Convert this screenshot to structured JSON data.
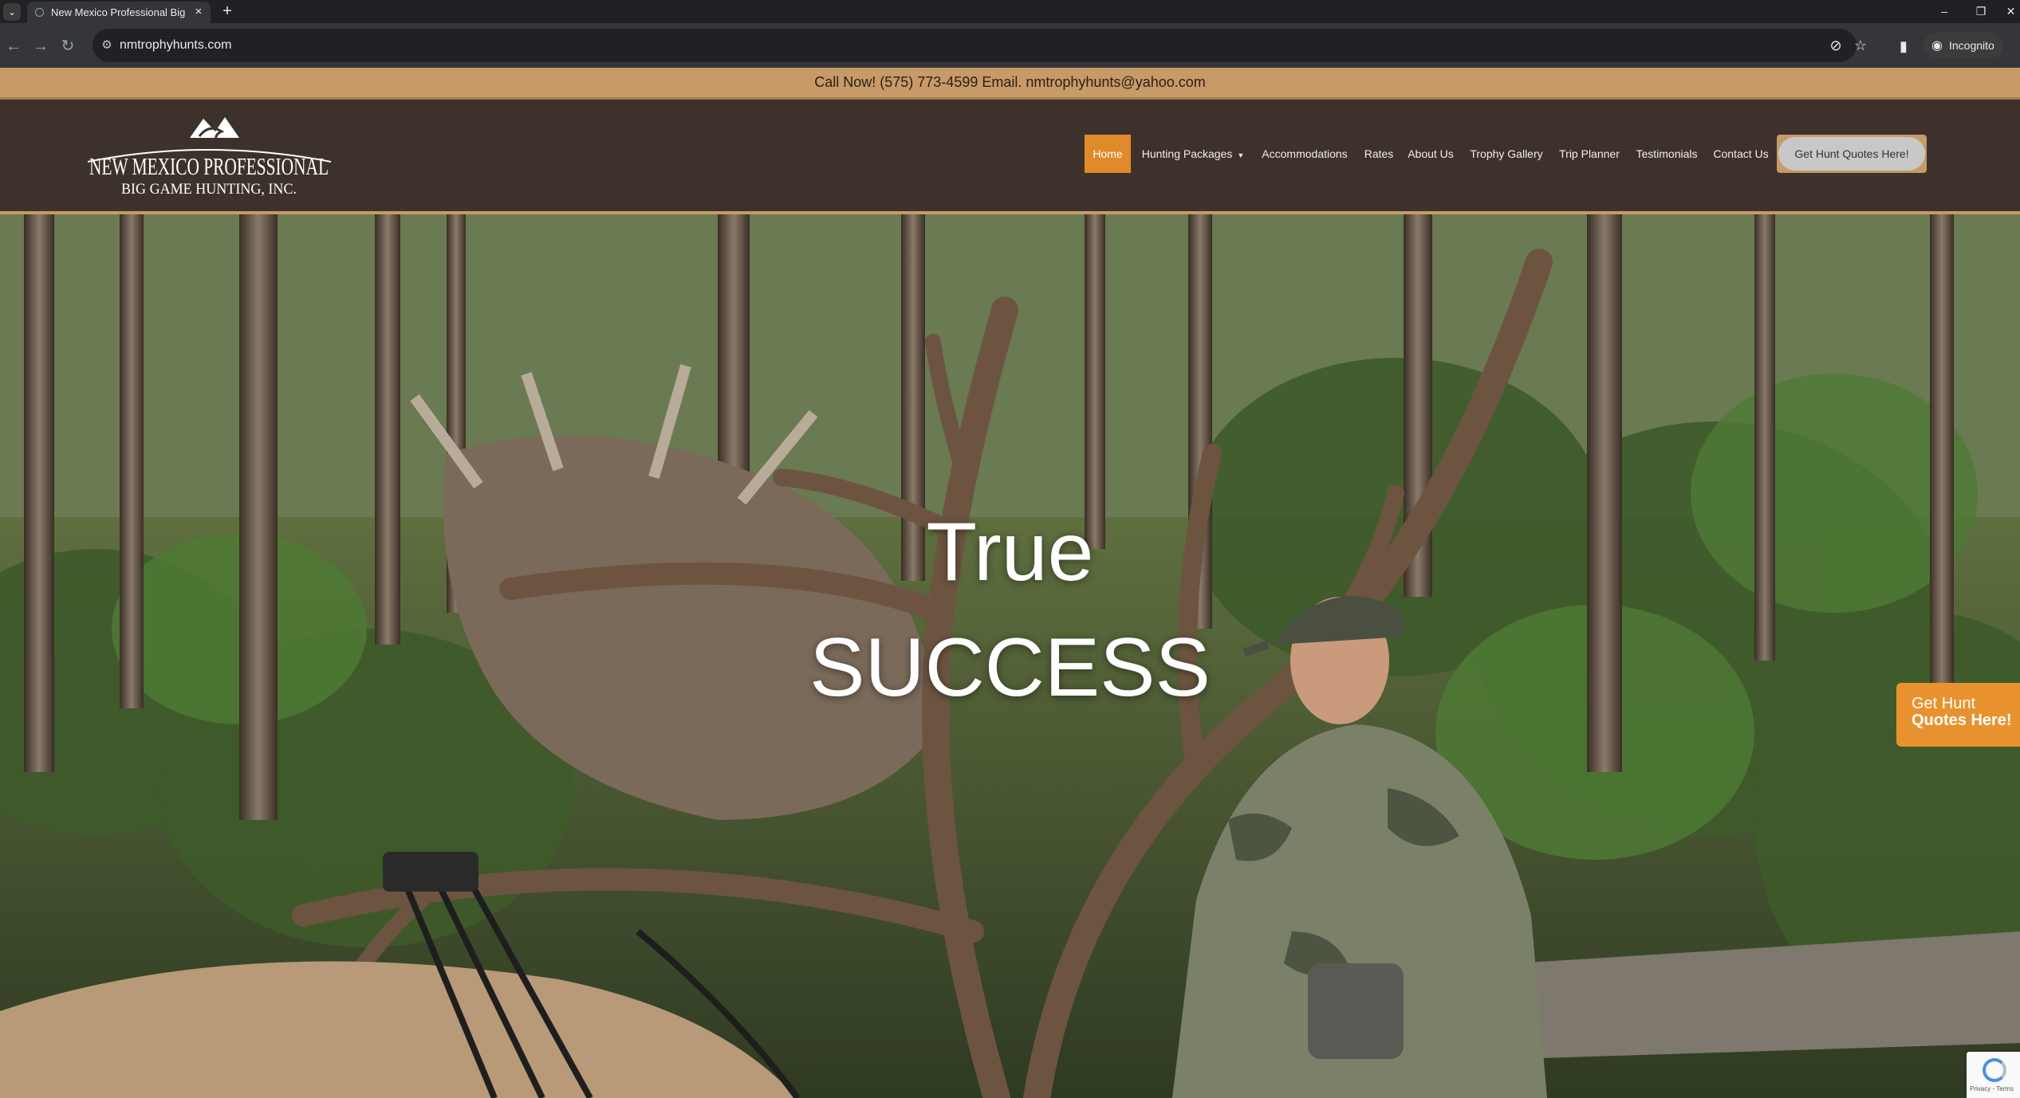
{
  "browser": {
    "tab_title": "New Mexico Professional Big G",
    "url": "nmtrophyhunts.com",
    "incognito_label": "Incognito",
    "window_controls": [
      "–",
      "❐",
      "✕"
    ]
  },
  "site": {
    "top_bar_text": "Call Now! (575) 773-4599 Email. nmtrophyhunts@yahoo.com",
    "logo_line1": "NEW MEXICO PROFESSIONAL",
    "logo_line2": "BIG GAME HUNTING, INC.",
    "nav": [
      {
        "label": "Home",
        "active": true
      },
      {
        "label": "Hunting Packages",
        "has_dropdown": true
      },
      {
        "label": "Accommodations"
      },
      {
        "label": "Rates"
      },
      {
        "label": "About Us"
      },
      {
        "label": "Trophy Gallery"
      },
      {
        "label": "Trip Planner"
      },
      {
        "label": "Testimonials"
      },
      {
        "label": "Contact Us"
      }
    ],
    "quote_button": "Get Hunt Quotes Here!",
    "hero": {
      "line1": "True",
      "line2": "SUCCESS"
    },
    "side_quote": {
      "line1": "Get Hunt",
      "line2": "Quotes Here!"
    },
    "recaptcha_text": "Privacy - Terms",
    "colors": {
      "accent": "#e08a2a",
      "top_bar": "#c79a68",
      "header": "#3d322b"
    }
  }
}
